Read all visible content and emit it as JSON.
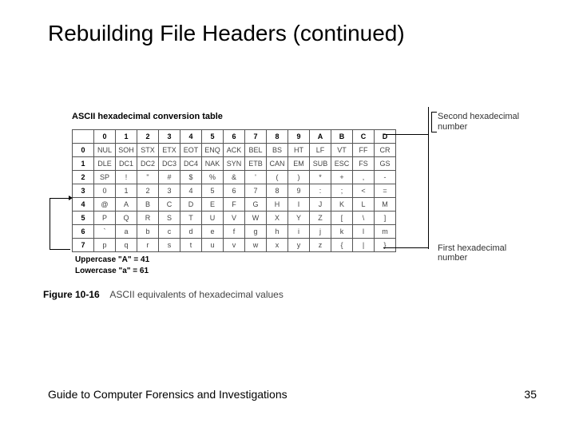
{
  "title": "Rebuilding File Headers (continued)",
  "figure": {
    "table_title": "ASCII hexadecimal conversion table",
    "col_headers": [
      "0",
      "1",
      "2",
      "3",
      "4",
      "5",
      "6",
      "7",
      "8",
      "9",
      "A",
      "B",
      "C",
      "D"
    ],
    "row_headers": [
      "0",
      "1",
      "2",
      "3",
      "4",
      "5",
      "6",
      "7"
    ],
    "rows": [
      [
        "NUL",
        "SOH",
        "STX",
        "ETX",
        "EOT",
        "ENQ",
        "ACK",
        "BEL",
        "BS",
        "HT",
        "LF",
        "VT",
        "FF",
        "CR"
      ],
      [
        "DLE",
        "DC1",
        "DC2",
        "DC3",
        "DC4",
        "NAK",
        "SYN",
        "ETB",
        "CAN",
        "EM",
        "SUB",
        "ESC",
        "FS",
        "GS"
      ],
      [
        "SP",
        "!",
        "\"",
        "#",
        "$",
        "%",
        "&",
        "'",
        "(",
        ")",
        "*",
        "+",
        ",",
        "-"
      ],
      [
        "0",
        "1",
        "2",
        "3",
        "4",
        "5",
        "6",
        "7",
        "8",
        "9",
        ":",
        ";",
        "<",
        "="
      ],
      [
        "@",
        "A",
        "B",
        "C",
        "D",
        "E",
        "F",
        "G",
        "H",
        "I",
        "J",
        "K",
        "L",
        "M"
      ],
      [
        "P",
        "Q",
        "R",
        "S",
        "T",
        "U",
        "V",
        "W",
        "X",
        "Y",
        "Z",
        "[",
        "\\",
        "]"
      ],
      [
        "`",
        "a",
        "b",
        "c",
        "d",
        "e",
        "f",
        "g",
        "h",
        "i",
        "j",
        "k",
        "l",
        "m"
      ],
      [
        "p",
        "q",
        "r",
        "s",
        "t",
        "u",
        "v",
        "w",
        "x",
        "y",
        "z",
        "{",
        "|",
        "}"
      ]
    ],
    "note_upper": "Uppercase \"A\" = 41",
    "note_lower": "Lowercase \"a\" = 61",
    "fig_num": "Figure 10-16",
    "caption": "ASCII equivalents of hexadecimal values",
    "callout_second_l1": "Second hexadecimal",
    "callout_second_l2": "number",
    "callout_first": "First hexadecimal number"
  },
  "footer": {
    "left": "Guide to Computer Forensics and Investigations",
    "page": "35"
  }
}
